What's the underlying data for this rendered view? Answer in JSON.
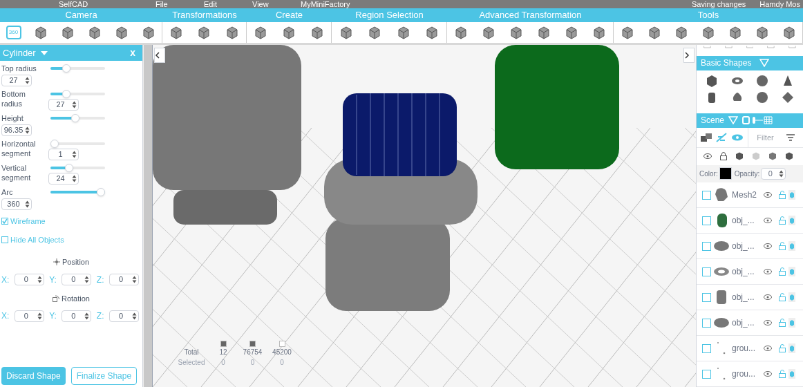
{
  "top_bar": {
    "logo": "SelfCAD",
    "menus": [
      "File",
      "Edit",
      "View",
      "MyMiniFactory"
    ],
    "status": "Saving changes",
    "user": "Hamdy Mos"
  },
  "categories": [
    {
      "label": "Camera"
    },
    {
      "label": "Transformations"
    },
    {
      "label": "Create"
    },
    {
      "label": "Region Selection"
    },
    {
      "label": "Advanced Transformation"
    },
    {
      "label": "Tools"
    }
  ],
  "camera_tool": {
    "label": "360",
    "selected": true
  },
  "panel": {
    "title": "Cylinder",
    "close": "x",
    "params": [
      {
        "label": "Top radius",
        "value": "27",
        "level": 0.25
      },
      {
        "label": "Bottom radius",
        "value": "27",
        "level": 0.25
      },
      {
        "label": "Height",
        "value": "96.35",
        "level": 0.45
      },
      {
        "label": "Horizontal segment",
        "value": "1",
        "level": 0
      },
      {
        "label": "Vertical segment",
        "value": "24",
        "level": 0.32
      },
      {
        "label": "Arc",
        "value": "360",
        "level": 1
      }
    ],
    "options": [
      {
        "label": "Wireframe",
        "checked": true
      },
      {
        "label": "Hide All Objects",
        "checked": false
      }
    ],
    "position": {
      "title": "Position",
      "fields": [
        {
          "label": "X:",
          "value": "0"
        },
        {
          "label": "Y:",
          "value": "0"
        },
        {
          "label": "Z:",
          "value": "0"
        }
      ]
    },
    "rotation": {
      "title": "Rotation",
      "fields": [
        {
          "label": "X:",
          "value": "0"
        },
        {
          "label": "Y:",
          "value": "0"
        },
        {
          "label": "Z:",
          "value": "0"
        }
      ]
    },
    "buttons": [
      {
        "label": "Discard Shape",
        "kind": "primary"
      },
      {
        "label": "Finalize Shape",
        "kind": "outline"
      }
    ]
  },
  "stats": {
    "rows": [
      {
        "label": "Total",
        "values": [
          "12",
          "76754",
          "45200"
        ]
      },
      {
        "label": "Selected",
        "values": [
          "0",
          "0",
          "0"
        ]
      }
    ]
  },
  "basic_shapes": {
    "title": "Basic Shapes"
  },
  "scene": {
    "title": "Scene",
    "filter_placeholder": "Filter",
    "color_label": "Color:",
    "color": "#000000",
    "opacity_label": "Opacity:",
    "opacity": "0",
    "items": [
      {
        "name": "Mesh2",
        "kind": "figure",
        "checked": false
      },
      {
        "name": "obj_...",
        "kind": "green-cylinder",
        "checked": false
      },
      {
        "name": "obj_...",
        "kind": "disc",
        "checked": false
      },
      {
        "name": "obj_...",
        "kind": "torus",
        "checked": false
      },
      {
        "name": "obj_...",
        "kind": "cylinder",
        "checked": false
      },
      {
        "name": "obj_...",
        "kind": "disc",
        "checked": false
      },
      {
        "name": "grou...",
        "kind": "dots",
        "checked": false
      },
      {
        "name": "grou...",
        "kind": "dots",
        "checked": false
      }
    ]
  }
}
